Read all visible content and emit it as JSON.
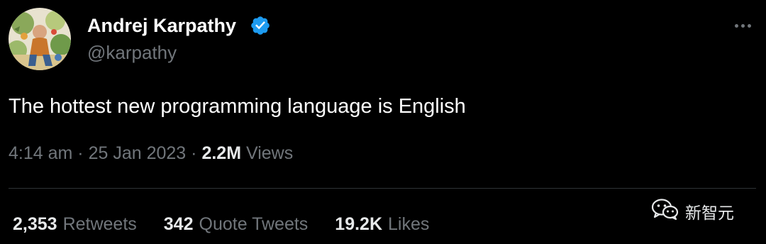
{
  "tweet": {
    "author": {
      "display_name": "Andrej Karpathy",
      "handle": "@karpathy",
      "verified": true,
      "verified_color": "#1d9bf0"
    },
    "text": "The hottest new programming language is English",
    "time": "4:14 am",
    "date": "25 Jan 2023",
    "views_count": "2.2M",
    "views_label": "Views",
    "stats": [
      {
        "count": "2,353",
        "label": "Retweets"
      },
      {
        "count": "342",
        "label": "Quote Tweets"
      },
      {
        "count": "19.2K",
        "label": "Likes"
      }
    ]
  },
  "icons": {
    "more": "more-horizontal-icon",
    "verified": "verified-badge-icon",
    "watermark": "wechat-icon"
  },
  "watermark": {
    "text": "新智元"
  },
  "colors": {
    "background": "#000000",
    "primary_text": "#e7e9ea",
    "secondary_text": "#71767b",
    "divider": "#2f3336"
  }
}
